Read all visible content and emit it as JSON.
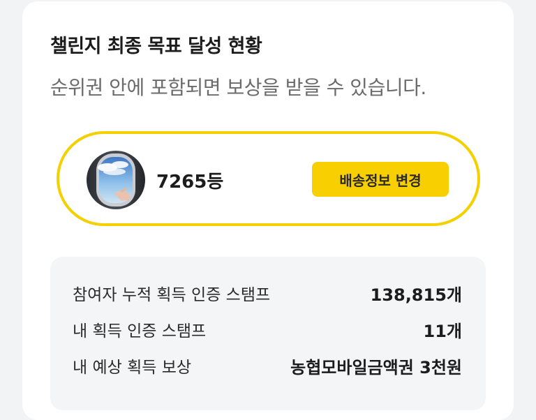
{
  "header": {
    "title": "챌린지 최종 목표 달성 현황",
    "subtitle": "순위권 안에 포함되면 보상을 받을 수 있습니다."
  },
  "rank_card": {
    "avatar_icon": "airplane-window-photo",
    "rank": "7265등",
    "shipping_button_label": "배송정보 변경",
    "border_color": "#f5d000",
    "button_color": "#f8cf00"
  },
  "stats": [
    {
      "label": "참여자 누적 획득 인증 스탬프",
      "value": "138,815개"
    },
    {
      "label": "내 획득 인증 스탬프",
      "value": "11개"
    },
    {
      "label": "내 예상 획득 보상",
      "value": "농협모바일금액권 3천원"
    }
  ]
}
